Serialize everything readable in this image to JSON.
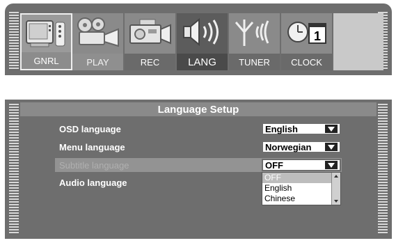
{
  "menubar": {
    "tabs": [
      {
        "label": "GNRL",
        "icon": "tv-remote-icon"
      },
      {
        "label": "PLAY",
        "icon": "film-projector-icon"
      },
      {
        "label": "REC",
        "icon": "camcorder-icon"
      },
      {
        "label": "LANG",
        "icon": "speaker-icon"
      },
      {
        "label": "TUNER",
        "icon": "antenna-icon"
      },
      {
        "label": "CLOCK",
        "icon": "clock-calendar-icon",
        "calendar_day": "1"
      }
    ]
  },
  "language_setup": {
    "title": "Language Setup",
    "rows": [
      {
        "label": "OSD language",
        "value": "English"
      },
      {
        "label": "Menu language",
        "value": "Norwegian"
      },
      {
        "label": "Subtitle language",
        "value": "OFF"
      },
      {
        "label": "Audio language",
        "value": ""
      }
    ],
    "dropdown_options": [
      "OFF",
      "English",
      "Chinese"
    ]
  }
}
